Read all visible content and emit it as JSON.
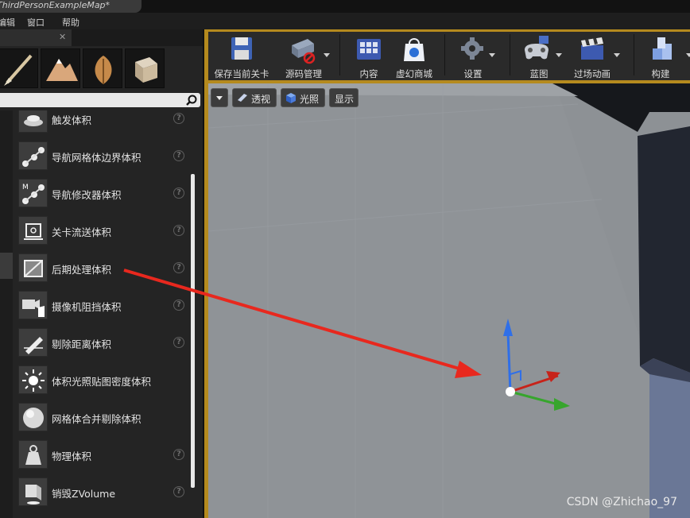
{
  "window": {
    "tab_title": "ThirdPersonExampleMap*"
  },
  "menubar": {
    "items": [
      "编辑",
      "窗口",
      "帮助"
    ]
  },
  "search": {
    "placeholder": ""
  },
  "place_list": {
    "items": [
      {
        "label": "触发体积",
        "icon": "trigger-volume-icon"
      },
      {
        "label": "导航网格体边界体积",
        "icon": "nav-mesh-bounds-icon"
      },
      {
        "label": "导航修改器体积",
        "icon": "nav-modifier-icon"
      },
      {
        "label": "关卡流送体积",
        "icon": "level-streaming-icon"
      },
      {
        "label": "后期处理体积",
        "icon": "post-process-icon"
      },
      {
        "label": "摄像机阻挡体积",
        "icon": "camera-blocking-icon"
      },
      {
        "label": "剔除距离体积",
        "icon": "cull-distance-icon"
      },
      {
        "label": "体积光照贴图密度体积",
        "icon": "lightmap-density-icon"
      },
      {
        "label": "网格体合并剔除体积",
        "icon": "mesh-merge-cull-icon"
      },
      {
        "label": "物理体积",
        "icon": "physics-volume-icon"
      },
      {
        "label": "销毁ZVolume",
        "icon": "kill-z-icon"
      }
    ],
    "help_glyph": "?"
  },
  "toolbar": {
    "buttons": [
      {
        "label": "保存当前关卡",
        "icon": "save-icon"
      },
      {
        "label": "源码管理",
        "icon": "source-control-icon"
      },
      {
        "label": "内容",
        "icon": "content-icon"
      },
      {
        "label": "虚幻商城",
        "icon": "marketplace-icon"
      },
      {
        "label": "设置",
        "icon": "settings-icon"
      },
      {
        "label": "蓝图",
        "icon": "blueprint-icon"
      },
      {
        "label": "过场动画",
        "icon": "cinematics-icon"
      },
      {
        "label": "构建",
        "icon": "build-icon"
      }
    ]
  },
  "viewport": {
    "perspective": "透视",
    "lit": "光照",
    "show": "显示"
  },
  "watermark": "CSDN @Zhichao_97",
  "colors": {
    "accent": "#b58a1e",
    "annotation_arrow": "#e8281e"
  }
}
